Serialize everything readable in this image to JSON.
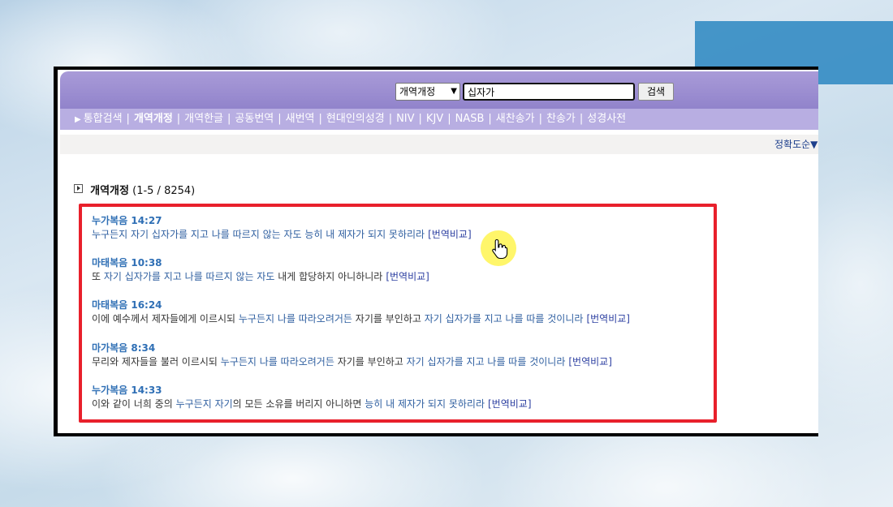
{
  "search": {
    "version_selected": "개역개정",
    "query": "십자가",
    "button_label": "검색"
  },
  "nav": {
    "items": [
      {
        "label": "통합검색"
      },
      {
        "label": "개역개정"
      },
      {
        "label": "개역한글"
      },
      {
        "label": "공동번역"
      },
      {
        "label": "새번역"
      },
      {
        "label": "현대인의성경"
      },
      {
        "label": "NIV"
      },
      {
        "label": "KJV"
      },
      {
        "label": "NASB"
      },
      {
        "label": "새찬송가"
      },
      {
        "label": "찬송가"
      },
      {
        "label": "성경사전"
      }
    ],
    "separator": "|"
  },
  "sort": {
    "label": "정확도순▼"
  },
  "results": {
    "title": "개역개정",
    "range": "(1-5 / 8254)",
    "compare_label": "[번역비교]",
    "verses": [
      {
        "ref": "누가복음 14:27",
        "segments": [
          {
            "t": "누구든지 자기 십자가를 지고 나를 따르지 않는 자도 능히 내 제자가 되지 못하리라",
            "h": true
          }
        ]
      },
      {
        "ref": "마태복음 10:38",
        "segments": [
          {
            "t": "또 ",
            "h": false
          },
          {
            "t": "자기 십자가를 지고 나를 따르지 않는 자도",
            "h": true
          },
          {
            "t": " 내게 합당하지 아니하니라",
            "h": false
          }
        ]
      },
      {
        "ref": "마태복음 16:24",
        "segments": [
          {
            "t": "이에 예수께서 제자들에게 이르시되 ",
            "h": false
          },
          {
            "t": "누구든지 나를 따라오려거든",
            "h": true
          },
          {
            "t": " 자기를 부인하고 ",
            "h": false
          },
          {
            "t": "자기 십자가를 지고 나를 따를 것이니라",
            "h": true
          }
        ]
      },
      {
        "ref": "마가복음 8:34",
        "segments": [
          {
            "t": "무리와 제자들을 불러 이르시되 ",
            "h": false
          },
          {
            "t": "누구든지 나를 따라오려거든",
            "h": true
          },
          {
            "t": " 자기를 부인하고 ",
            "h": false
          },
          {
            "t": "자기 십자가를 지고 나를 따를 것이니라",
            "h": true
          }
        ]
      },
      {
        "ref": "누가복음 14:33",
        "segments": [
          {
            "t": "이와 같이 너희 중의 ",
            "h": false
          },
          {
            "t": "누구든지 자기",
            "h": true
          },
          {
            "t": "의 모든 소유를 버리지 아니하면 ",
            "h": false
          },
          {
            "t": "능히 내 제자가 되지 못하리라",
            "h": true
          }
        ]
      }
    ]
  },
  "colors": {
    "topbar": "#9b8dd3",
    "navbar": "#b8aee2",
    "link": "#2f6fb5",
    "highlight_box": "#e8202b",
    "cursor_highlight": "#fff550"
  },
  "icons": {
    "cursor": "hand-pointer-icon",
    "header": "play-box-icon"
  }
}
